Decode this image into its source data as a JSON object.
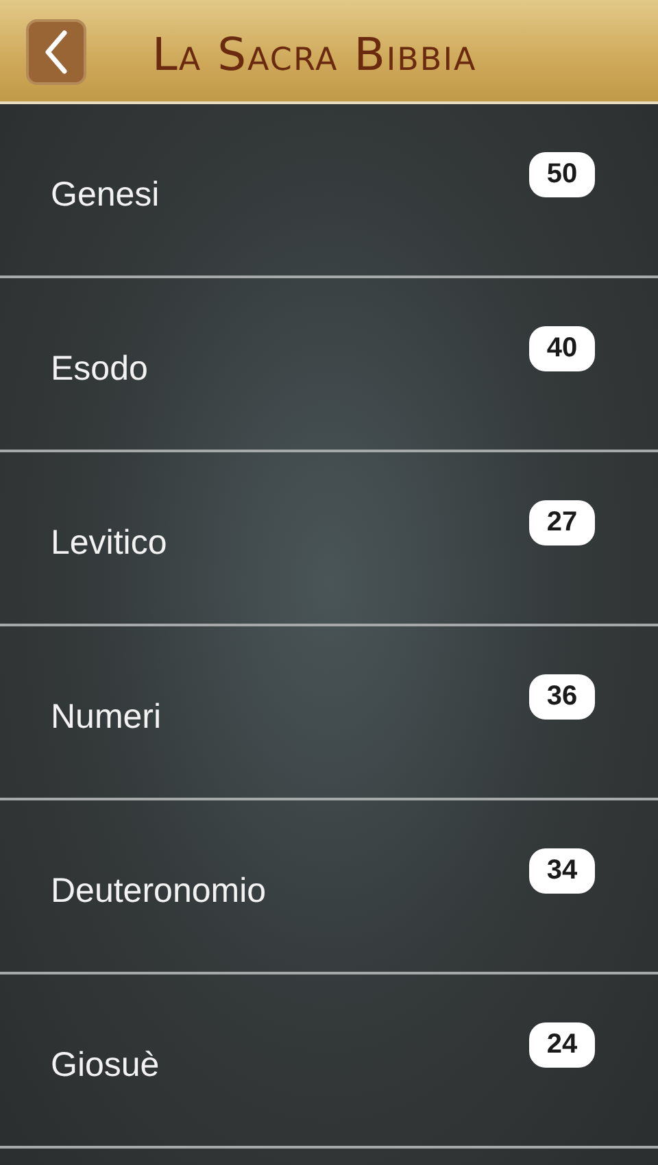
{
  "header": {
    "title": "La Sacra Bibbia"
  },
  "books": [
    {
      "name": "Genesi",
      "chapters": "50"
    },
    {
      "name": "Esodo",
      "chapters": "40"
    },
    {
      "name": "Levitico",
      "chapters": "27"
    },
    {
      "name": "Numeri",
      "chapters": "36"
    },
    {
      "name": "Deuteronomio",
      "chapters": "34"
    },
    {
      "name": "Giosuè",
      "chapters": "24"
    }
  ]
}
